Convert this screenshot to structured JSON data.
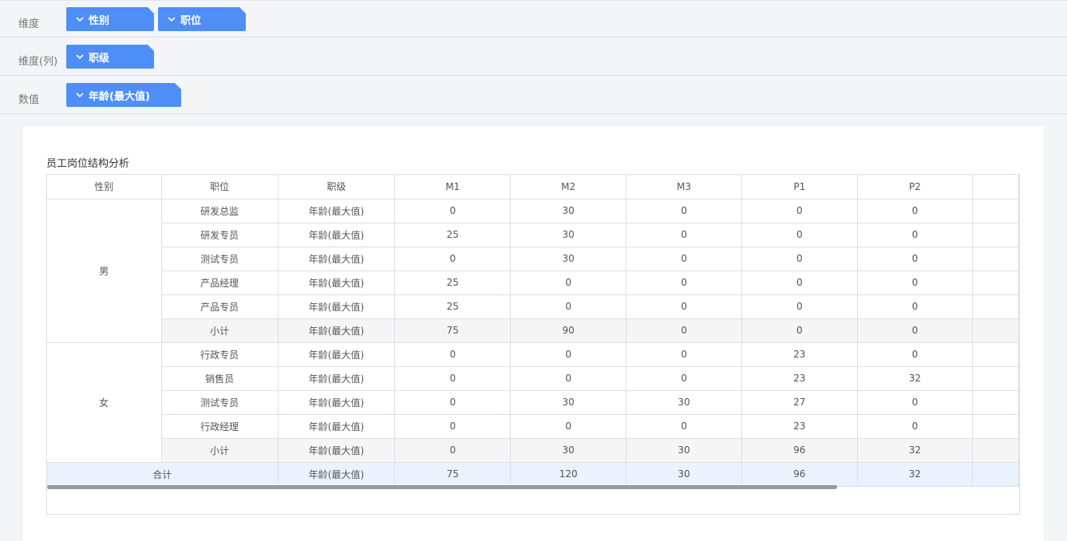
{
  "dimensions": {
    "rows_label": "维度",
    "rows_chips": [
      "性别",
      "职位"
    ],
    "cols_label": "维度(列)",
    "cols_chips": [
      "职级"
    ],
    "values_label": "数值",
    "values_chips": [
      "年龄(最大值)"
    ]
  },
  "report": {
    "title": "员工岗位结构分析",
    "headers": [
      "性别",
      "职位",
      "职级",
      "M1",
      "M2",
      "M3",
      "P1",
      "P2"
    ],
    "male": {
      "label": "男",
      "rows": [
        {
          "position": "研发总监",
          "metric": "年龄(最大值)",
          "values": [
            "0",
            "30",
            "0",
            "0",
            "0"
          ]
        },
        {
          "position": "研发专员",
          "metric": "年龄(最大值)",
          "values": [
            "25",
            "30",
            "0",
            "0",
            "0"
          ]
        },
        {
          "position": "测试专员",
          "metric": "年龄(最大值)",
          "values": [
            "0",
            "30",
            "0",
            "0",
            "0"
          ]
        },
        {
          "position": "产品经理",
          "metric": "年龄(最大值)",
          "values": [
            "25",
            "0",
            "0",
            "0",
            "0"
          ]
        },
        {
          "position": "产品专员",
          "metric": "年龄(最大值)",
          "values": [
            "25",
            "0",
            "0",
            "0",
            "0"
          ]
        },
        {
          "position": "小计",
          "metric": "年龄(最大值)",
          "values": [
            "75",
            "90",
            "0",
            "0",
            "0"
          ]
        }
      ]
    },
    "female": {
      "label": "女",
      "rows": [
        {
          "position": "行政专员",
          "metric": "年龄(最大值)",
          "values": [
            "0",
            "0",
            "0",
            "23",
            "0"
          ]
        },
        {
          "position": "销售员",
          "metric": "年龄(最大值)",
          "values": [
            "0",
            "0",
            "0",
            "23",
            "32"
          ]
        },
        {
          "position": "测试专员",
          "metric": "年龄(最大值)",
          "values": [
            "0",
            "30",
            "30",
            "27",
            "0"
          ]
        },
        {
          "position": "行政经理",
          "metric": "年龄(最大值)",
          "values": [
            "0",
            "0",
            "0",
            "23",
            "0"
          ]
        },
        {
          "position": "小计",
          "metric": "年龄(最大值)",
          "values": [
            "0",
            "30",
            "30",
            "96",
            "32"
          ]
        }
      ]
    },
    "total": {
      "label": "合计",
      "metric": "年龄(最大值)",
      "values": [
        "75",
        "120",
        "30",
        "96",
        "32"
      ]
    }
  },
  "colors": {
    "chip": "#4e8ef7",
    "total_row": "#ebf2fd",
    "subtotal_row": "#f5f5f5"
  }
}
